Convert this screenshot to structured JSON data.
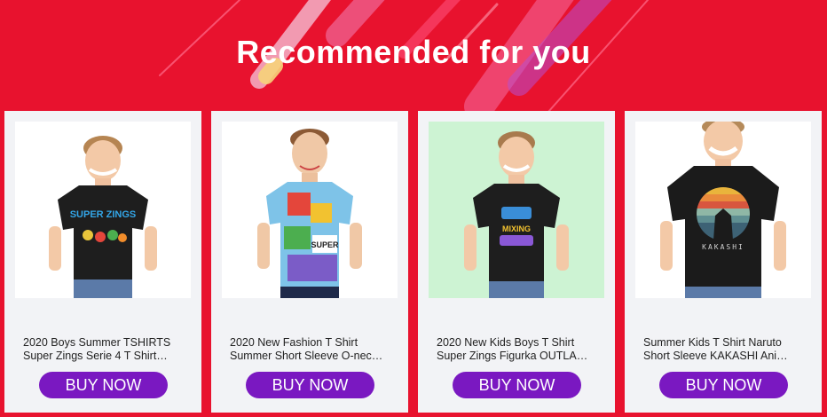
{
  "section": {
    "title": "Recommended for you"
  },
  "colors": {
    "background": "#e8122e",
    "card": "#f2f3f6",
    "button": "#7a18c1",
    "button_text": "#ffffff"
  },
  "products": [
    {
      "line1": "2020 Boys Summer TSHIRTS",
      "line2": "Super Zings Serie 4 T Shirt…",
      "button": "BUY NOW",
      "image": "boy-black-tshirt-superzings-icon"
    },
    {
      "line1": "2020 New Fashion T Shirt",
      "line2": "Summer Short Sleeve O-nec…",
      "button": "BUY NOW",
      "image": "boy-printed-tshirt-icon"
    },
    {
      "line1": "2020 New Kids Boys T Shirt",
      "line2": "Super Zings Figurka OUTLA…",
      "button": "BUY NOW",
      "image": "boy-black-tshirt-mixing-icon"
    },
    {
      "line1": "Summer Kids T Shirt Naruto",
      "line2": "Short Sleeve KAKASHI Ani…",
      "button": "BUY NOW",
      "image": "boy-black-tshirt-kakashi-icon"
    }
  ],
  "shirt_prints": {
    "p0": "SUPER ZINGS",
    "p1": "SUPER",
    "p2": "MIXING",
    "p3": "KAKASHI"
  }
}
